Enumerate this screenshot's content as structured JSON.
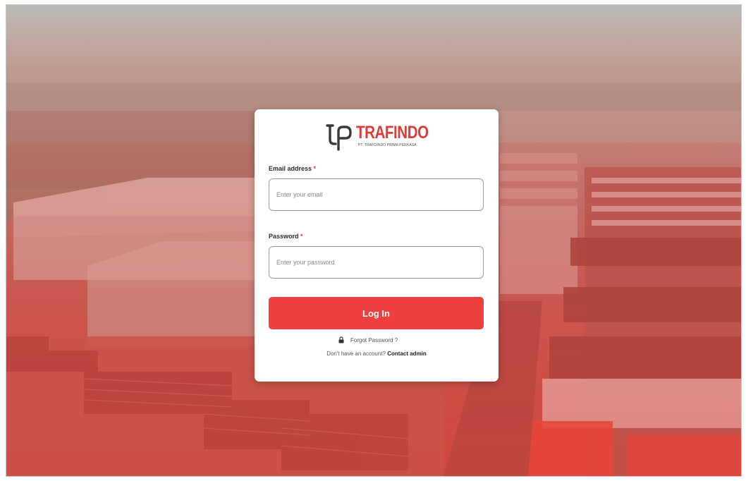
{
  "logo": {
    "name": "TRAFINDO",
    "subtitle": "PT. TRAFOINDO PRIMA PERKASA",
    "brand_color": "#e03a38"
  },
  "form": {
    "email": {
      "label": "Email address",
      "required_marker": "*",
      "placeholder": "Enter your email",
      "value": ""
    },
    "password": {
      "label": "Password",
      "required_marker": "*",
      "placeholder": "Enter your password",
      "value": ""
    },
    "login_button": {
      "label": "Log In",
      "color": "#ef3f3f"
    },
    "forgot_password": {
      "label": "Forgot Password ?",
      "icon": "lock-icon"
    },
    "signup": {
      "prompt": "Don't have an account?",
      "link_label": "Contact admin"
    }
  },
  "background": {
    "description_icon": "factory-aerial-photo",
    "overlay_color": "#e03a38"
  }
}
